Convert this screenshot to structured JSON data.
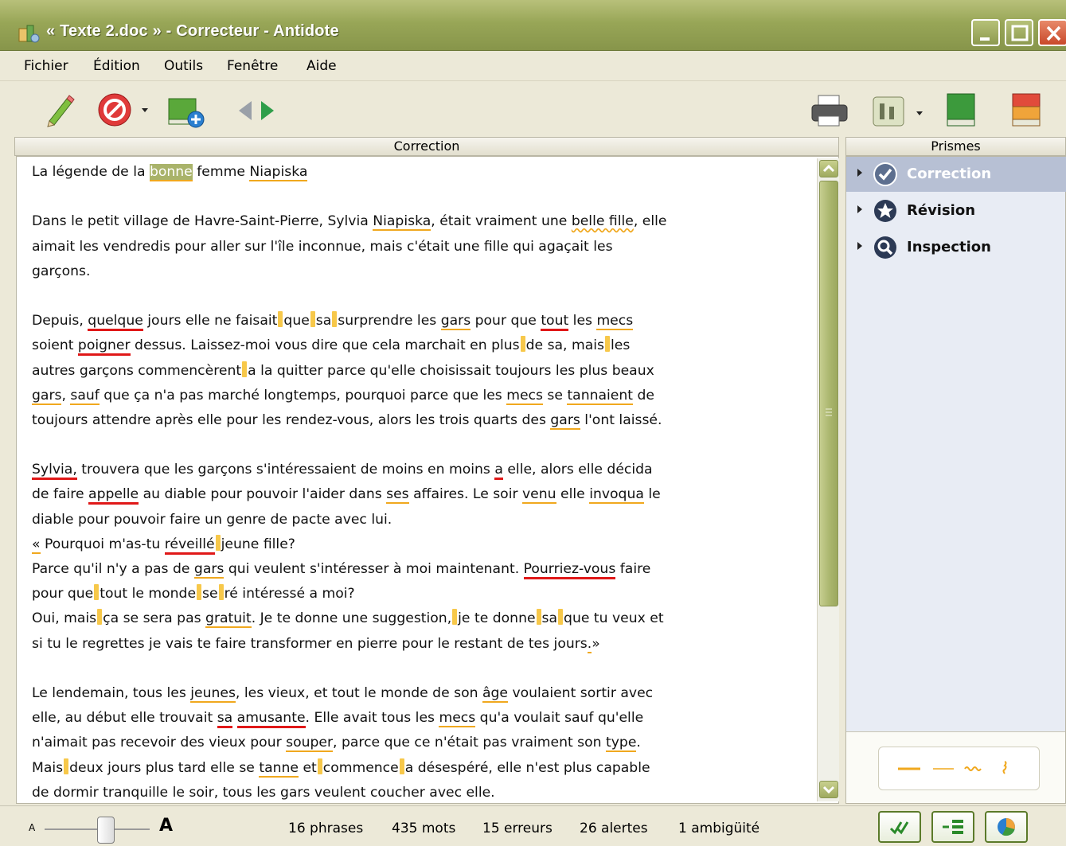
{
  "window": {
    "title": "« Texte 2.doc » - Correcteur - Antidote"
  },
  "menu": [
    "Fichier",
    "Édition",
    "Outils",
    "Fenêtre",
    "Aide"
  ],
  "toolbar": {
    "icons": [
      "pencil-icon",
      "stop-icon",
      "add-book-icon",
      "prev-arrow-icon",
      "next-arrow-icon",
      "print-icon",
      "view-options-icon",
      "green-book-icon",
      "red-book-icon"
    ]
  },
  "panels": {
    "correction_header": "Correction",
    "prisms_header": "Prismes"
  },
  "document": {
    "line1": "La légende de la ",
    "w_bonne": "bonne",
    "line1b": " femme ",
    "w_niapiska1": "Niapiska",
    "p2_a": "Dans le petit village de Havre-Saint-Pierre, Sylvia ",
    "w_niapiska2": "Niapiska",
    "p2_b": ", était vraiment une ",
    "w_bellefille": "belle fille",
    "p2_c": ", elle",
    "p2_line2": "aimait les vendredis pour aller sur l'île inconnue, mais c'était une fille qui agaçait les",
    "p2_line3": "garçons.",
    "p3_l1_a": "Depuis, ",
    "w_quelque": "quelque",
    "p3_l1_b": " jours elle ne faisait",
    "p3_l1_c": "que",
    "p3_l1_d": "sa",
    "p3_l1_e": "surprendre les ",
    "w_gars1": "gars",
    "p3_l1_f": " pour que ",
    "w_tout": "tout",
    "p3_l1_g": " les ",
    "w_mecs1": "mecs",
    "p3_l2_a": "soient ",
    "w_poigner": "poigner",
    "p3_l2_b": " dessus. Laissez-moi vous dire que cela marchait en plus",
    "p3_l2_c": "de sa, mais",
    "p3_l2_d": "les",
    "p3_l3_a": "autres garçons commencèrent",
    "p3_l3_b": "a la quitter parce qu'elle choisissait toujours les plus beaux",
    "w_gars2": "gars",
    "p3_l4_a": ", ",
    "w_sauf": "sauf",
    "p3_l4_b": "  que ça n'a pas marché longtemps, pourquoi parce que les ",
    "w_mecs2": "mecs",
    "p3_l4_c": " se ",
    "w_tannaient": "tannaient",
    "p3_l4_d": " de",
    "p3_l5_a": "toujours attendre après elle pour les rendez-vous, alors les trois quarts des ",
    "w_gars3": "gars",
    "p3_l5_b": " l'ont laissé.",
    "w_sylvia": "Sylvia,",
    "p4_l1_a": " trouvera que les garçons s'intéressaient de moins en moins ",
    "w_a": "a",
    "p4_l1_b": " elle, alors elle décida",
    "p4_l2_a": "de faire ",
    "w_appelle": "appelle",
    "p4_l2_b": " au diable pour pouvoir l'aider dans ",
    "w_ses": "ses",
    "p4_l2_c": " affaires. Le soir ",
    "w_venu": "venu",
    "p4_l2_d": " elle ",
    "w_invoqua": "invoqua",
    "p4_l2_e": " le",
    "p4_l3": "diable pour pouvoir faire un genre de pacte avec lui.",
    "w_guil": "«",
    "p4_l4_a": " Pourquoi m'as-tu ",
    "w_reveille": "réveillé",
    "p4_l4_b": "jeune fille?",
    "p4_l5_a": "Parce qu'il n'y a pas de ",
    "w_gars4": "gars",
    "p4_l5_b": " qui veulent s'intéresser à moi maintenant. ",
    "w_pourriez": "Pourriez-vous",
    "p4_l5_c": " faire",
    "p4_l6_a": "pour que",
    "p4_l6_b": "tout le monde",
    "p4_l6_c": "se",
    "p4_l6_d": "ré intéressé a moi?",
    "p4_l7_a": "Oui, mais",
    "p4_l7_b": "ça se sera pas ",
    "w_gratuit": "gratuit",
    "p4_l7_c": ". Je te donne une suggestion,",
    "p4_l7_d": "je te donne",
    "p4_l7_e": "sa",
    "p4_l7_f": "que tu veux et",
    "p4_l8_a": "si tu le regrettes je vais te faire transformer en pierre pour le restant de tes jours",
    "w_dot": ".",
    "p4_l8_b": "»",
    "p5_l1_a": "Le lendemain, tous les ",
    "w_jeunes": "jeunes",
    "p5_l1_b": ", les vieux, et tout le monde de son ",
    "w_age": "âge",
    "p5_l1_c": " voulaient sortir avec",
    "p5_l2_a": "elle, au début elle trouvait ",
    "w_sa": "sa",
    "p5_l2_b": " ",
    "w_amusante": "amusante",
    "p5_l2_c": ". Elle avait tous les ",
    "w_mecs3": "mecs",
    "p5_l2_d": " qu'a voulait sauf qu'elle",
    "p5_l3_a": "n'aimait pas recevoir des vieux pour ",
    "w_souper": "souper",
    "p5_l3_b": ", parce que ce n'était pas vraiment son ",
    "w_type": "type",
    "p5_l3_c": ".",
    "p5_l4_a": "Mais",
    "p5_l4_b": "deux jours plus tard elle se ",
    "w_tanne": "tanne",
    "p5_l4_c": " et",
    "p5_l4_d": "commence",
    "p5_l4_e": "a désespéré, elle n'est plus capable",
    "p5_l5": "de dormir tranquille le soir, tous les gars veulent coucher avec elle."
  },
  "prisms": [
    {
      "label": "Correction",
      "icon": "check-icon",
      "selected": true
    },
    {
      "label": "Révision",
      "icon": "star-icon",
      "selected": false
    },
    {
      "label": "Inspection",
      "icon": "magnifier-icon",
      "selected": false
    }
  ],
  "status": {
    "font_small": "A",
    "font_large": "A",
    "phrases": "16 phrases",
    "mots": "435 mots",
    "erreurs": "15 erreurs",
    "alertes": "26 alertes",
    "ambiguite": "1 ambigüité"
  },
  "colors": {
    "error": "#e01818",
    "alert": "#f0a81e",
    "title_bar": "#98a657",
    "selection": "#a9b36a"
  }
}
